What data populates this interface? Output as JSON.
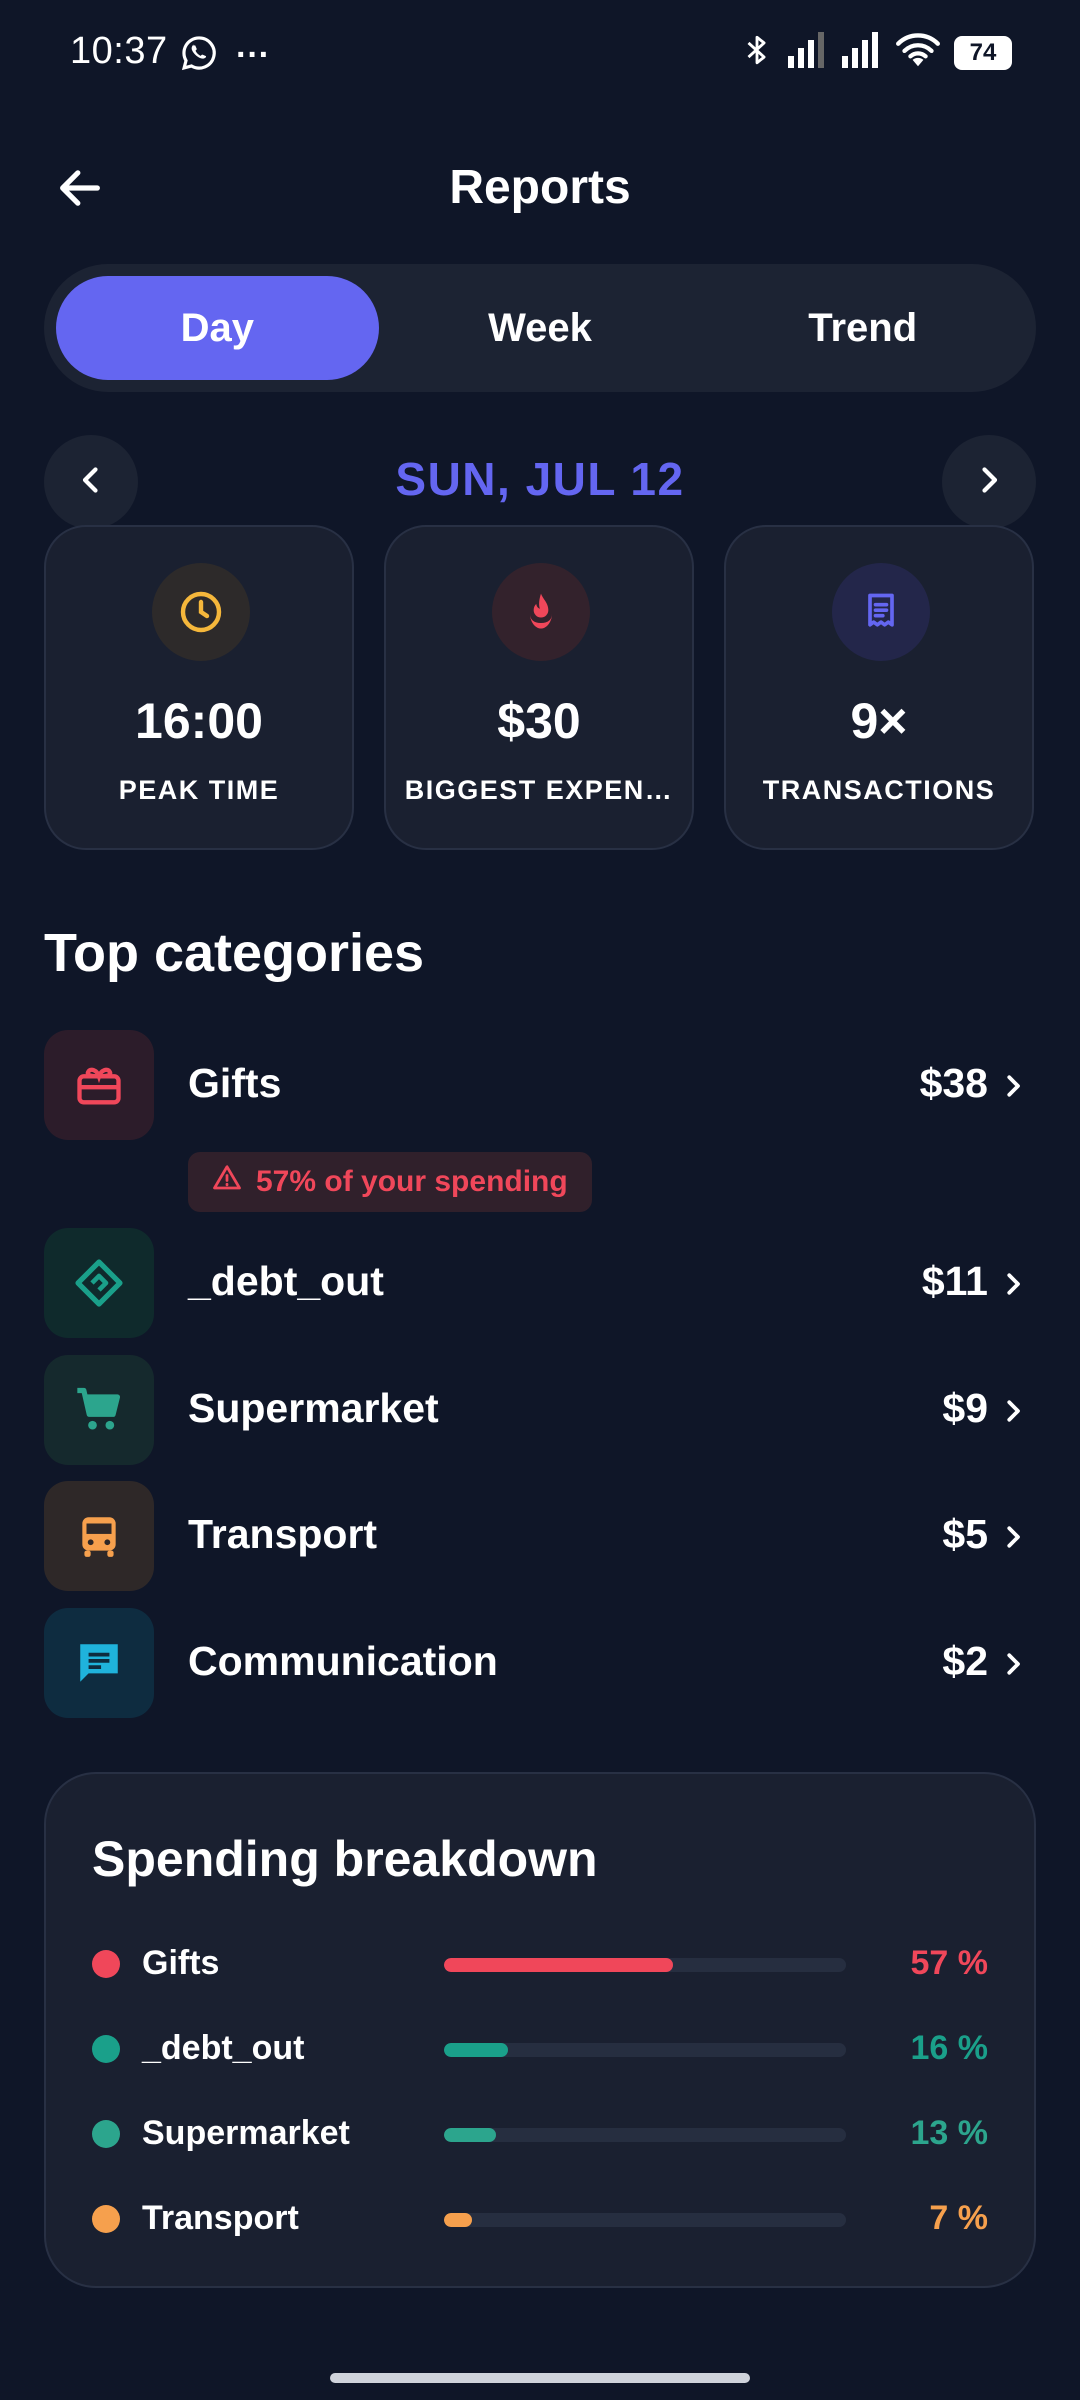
{
  "status_bar": {
    "time": "10:37",
    "dots": "···",
    "battery": "74"
  },
  "header": {
    "title": "Reports"
  },
  "tabs": [
    {
      "label": "Day",
      "active": true
    },
    {
      "label": "Week",
      "active": false
    },
    {
      "label": "Trend",
      "active": false
    }
  ],
  "date_nav": {
    "date": "SUN, JUL 12"
  },
  "stats": [
    {
      "value": "16:00",
      "label": "PEAK TIME",
      "icon": "clock-icon",
      "color": "#f5b73b",
      "bg": "#2d2a2a"
    },
    {
      "value": "$30",
      "label": "BIGGEST EXPEN…",
      "icon": "fire-icon",
      "color": "#f0475a",
      "bg": "#33222c"
    },
    {
      "value": "9×",
      "label": "TRANSACTIONS",
      "icon": "receipt-icon",
      "color": "#6466f1",
      "bg": "#23264a"
    }
  ],
  "top_categories": {
    "title": "Top categories",
    "warning": "57% of your spending",
    "items": [
      {
        "name": "Gifts",
        "amount": "$38",
        "icon": "gift-icon",
        "color": "#f0475a",
        "bg": "#2c1c2a"
      },
      {
        "name": "_debt_out",
        "amount": "$11",
        "icon": "handshake-icon",
        "color": "#1aa08a",
        "bg": "#0f2a2c"
      },
      {
        "name": "Supermarket",
        "amount": "$9",
        "icon": "cart-icon",
        "color": "#2ca58d",
        "bg": "#15292d"
      },
      {
        "name": "Transport",
        "amount": "$5",
        "icon": "bus-icon",
        "color": "#f6a04d",
        "bg": "#2e2828"
      },
      {
        "name": "Communication",
        "amount": "$2",
        "icon": "chat-icon",
        "color": "#1fb3dc",
        "bg": "#0e2c40"
      }
    ]
  },
  "breakdown": {
    "title": "Spending breakdown",
    "rows": [
      {
        "name": "Gifts",
        "pct_label": "57 %",
        "fraction": 0.57,
        "color": "#f0475a"
      },
      {
        "name": "_debt_out",
        "pct_label": "16 %",
        "fraction": 0.16,
        "color": "#1aa08a"
      },
      {
        "name": "Supermarket",
        "pct_label": "13 %",
        "fraction": 0.13,
        "color": "#2ca58d"
      },
      {
        "name": "Transport",
        "pct_label": "7 %",
        "fraction": 0.07,
        "color": "#f6a04d"
      }
    ]
  }
}
